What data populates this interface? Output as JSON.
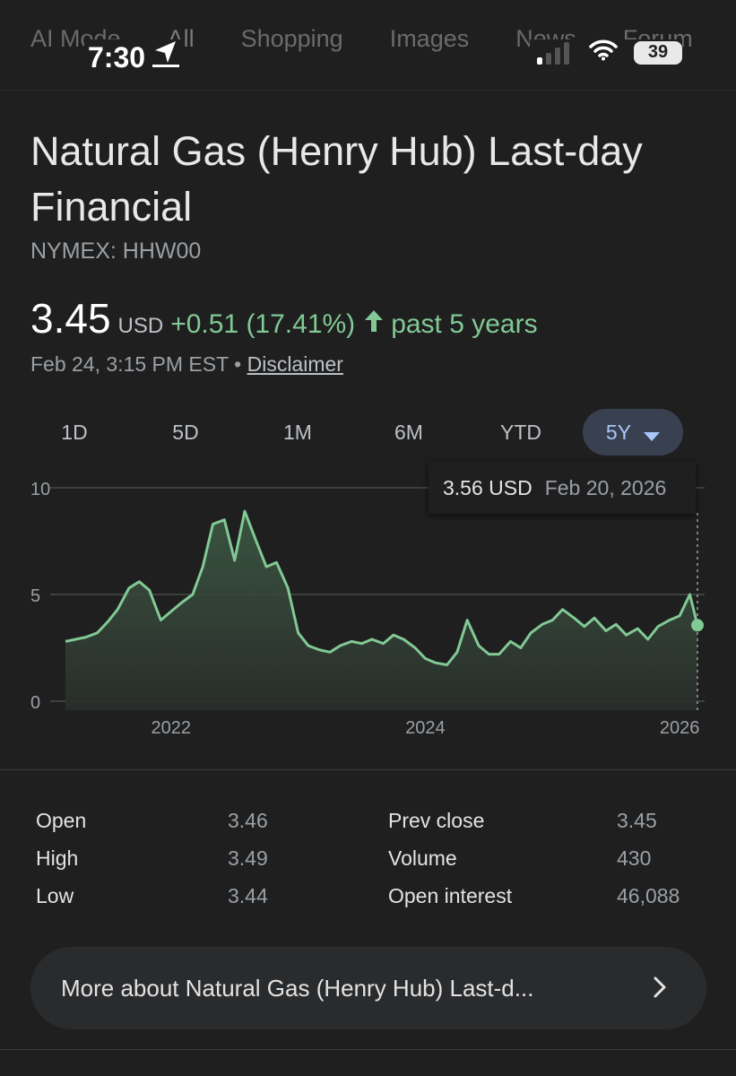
{
  "search_tabs": [
    {
      "label": "AI Mode"
    },
    {
      "label": "All"
    },
    {
      "label": "Shopping"
    },
    {
      "label": "Images"
    },
    {
      "label": "News"
    },
    {
      "label": "Forum"
    }
  ],
  "status_bar": {
    "time": "7:30",
    "battery": "39",
    "icons": [
      "location-arrow-icon",
      "cell-signal-icon",
      "wifi-icon",
      "battery-icon"
    ]
  },
  "quote": {
    "title": "Natural Gas (Henry Hub) Last-day Financial",
    "ticker": "NYMEX: HHW00",
    "price": "3.45",
    "currency": "USD",
    "change": "+0.51 (17.41%)",
    "period": "past 5 years",
    "timestamp": "Feb 24, 3:15 PM EST",
    "separator": "•",
    "disclaimer": "Disclaimer"
  },
  "range_tabs": [
    {
      "label": "1D"
    },
    {
      "label": "5D"
    },
    {
      "label": "1M"
    },
    {
      "label": "6M"
    },
    {
      "label": "YTD"
    },
    {
      "label": "5Y"
    }
  ],
  "selected_range": "5Y",
  "tooltip": {
    "value": "3.56 USD",
    "date": "Feb 20, 2026"
  },
  "chart_data": {
    "type": "area",
    "x_unit": "year",
    "x": [
      2021.17,
      2021.25,
      2021.33,
      2021.42,
      2021.5,
      2021.58,
      2021.67,
      2021.75,
      2021.83,
      2021.92,
      2022.0,
      2022.08,
      2022.17,
      2022.25,
      2022.33,
      2022.42,
      2022.5,
      2022.58,
      2022.67,
      2022.75,
      2022.83,
      2022.92,
      2023.0,
      2023.08,
      2023.17,
      2023.25,
      2023.33,
      2023.42,
      2023.5,
      2023.58,
      2023.67,
      2023.75,
      2023.83,
      2023.92,
      2024.0,
      2024.08,
      2024.17,
      2024.25,
      2024.33,
      2024.42,
      2024.5,
      2024.58,
      2024.67,
      2024.75,
      2024.83,
      2024.92,
      2025.0,
      2025.08,
      2025.17,
      2025.25,
      2025.33,
      2025.42,
      2025.5,
      2025.58,
      2025.67,
      2025.75,
      2025.83,
      2025.92,
      2026.0,
      2026.08,
      2026.14
    ],
    "y": [
      2.8,
      2.9,
      3.0,
      3.2,
      3.7,
      4.3,
      5.3,
      5.6,
      5.2,
      3.8,
      4.2,
      4.6,
      5.0,
      6.3,
      8.3,
      8.5,
      6.6,
      8.9,
      7.5,
      6.3,
      6.5,
      5.3,
      3.2,
      2.6,
      2.4,
      2.3,
      2.6,
      2.8,
      2.7,
      2.9,
      2.7,
      3.1,
      2.9,
      2.5,
      2.0,
      1.8,
      1.7,
      2.3,
      3.8,
      2.6,
      2.2,
      2.2,
      2.8,
      2.5,
      3.2,
      3.6,
      3.8,
      4.3,
      3.9,
      3.5,
      3.9,
      3.3,
      3.6,
      3.1,
      3.4,
      2.9,
      3.5,
      3.8,
      4.0,
      5.0,
      3.56
    ],
    "xticks": [
      "2022",
      "2024",
      "2026"
    ],
    "xtick_values": [
      2022,
      2024,
      2026
    ],
    "yticks": [
      "10",
      "5",
      "0"
    ],
    "ytick_values": [
      10,
      5,
      0
    ],
    "xlim": [
      2021.17,
      2026.14
    ],
    "ylim": [
      0,
      10
    ],
    "grid": true,
    "line_color": "#81c995",
    "fill_color": "#2b3a2f",
    "marker_point": {
      "x": 2026.14,
      "y": 3.56
    }
  },
  "stats": [
    {
      "label": "Open",
      "value": "3.46",
      "label2": "Prev close",
      "value2": "3.45"
    },
    {
      "label": "High",
      "value": "3.49",
      "label2": "Volume",
      "value2": "430"
    },
    {
      "label": "Low",
      "value": "3.44",
      "label2": "Open interest",
      "value2": "46,088"
    }
  ],
  "more_button": {
    "label": "More about Natural Gas (Henry Hub) Last-d..."
  },
  "colors": {
    "background": "#1f1f1f",
    "positive": "#81c995",
    "selected_tab_bg": "#394150",
    "selected_tab_text": "#a8c7fa"
  }
}
